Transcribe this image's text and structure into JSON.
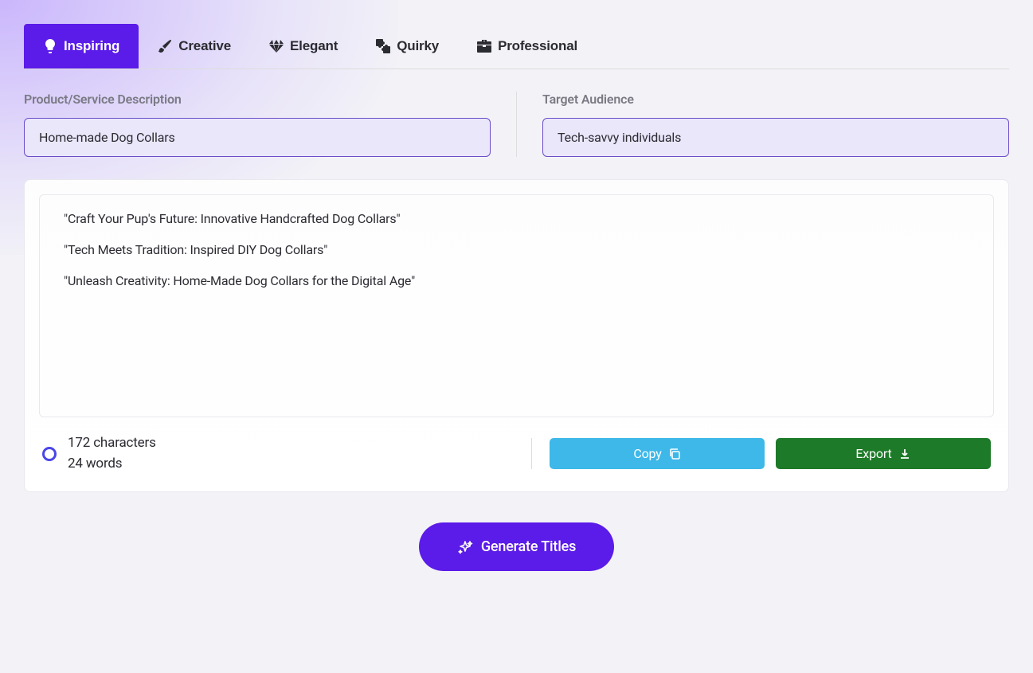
{
  "tabs": [
    {
      "label": "Inspiring",
      "icon": "lightbulb-icon",
      "active": true
    },
    {
      "label": "Creative",
      "icon": "brush-icon",
      "active": false
    },
    {
      "label": "Elegant",
      "icon": "gem-icon",
      "active": false
    },
    {
      "label": "Quirky",
      "icon": "puzzle-icon",
      "active": false
    },
    {
      "label": "Professional",
      "icon": "briefcase-icon",
      "active": false
    }
  ],
  "fields": {
    "product": {
      "label": "Product/Service Description",
      "value": "Home-made Dog Collars"
    },
    "audience": {
      "label": "Target Audience",
      "value": "Tech-savvy individuals"
    }
  },
  "results": [
    "\"Craft Your Pup's Future: Innovative Handcrafted Dog Collars\"",
    "\"Tech Meets Tradition: Inspired DIY Dog Collars\"",
    "\"Unleash Creativity: Home-Made Dog Collars for the Digital Age\""
  ],
  "stats": {
    "characters": "172 characters",
    "words": "24 words"
  },
  "buttons": {
    "copy": "Copy",
    "export": "Export",
    "generate": "Generate Titles"
  }
}
